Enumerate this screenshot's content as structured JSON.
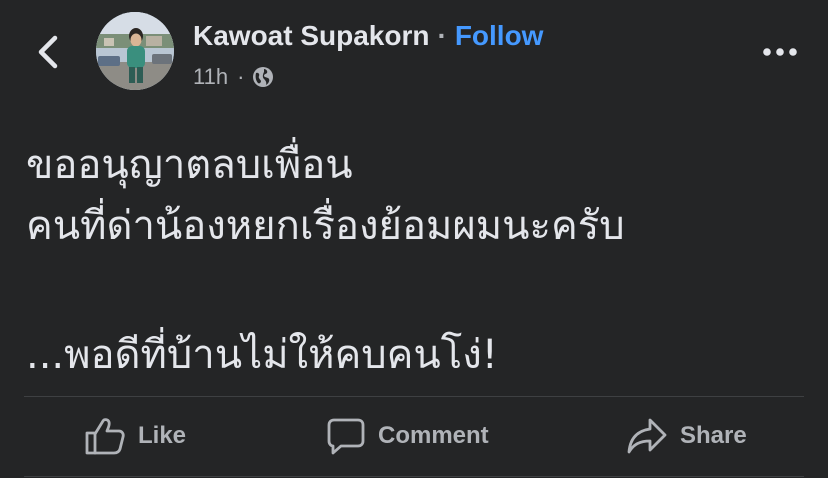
{
  "header": {
    "back_icon": "chevron-left-icon",
    "author_name": "Kawoat Supakorn",
    "separator": "·",
    "follow_label": "Follow",
    "timestamp": "11h",
    "meta_separator": "·",
    "audience_icon": "globe-icon",
    "more_icon": "more-horizontal-icon"
  },
  "post": {
    "lines": [
      "ขออนุญาตลบเพื่อน",
      "คนที่ด่าน้องหยกเรื่องย้อมผมนะครับ",
      "...พอดีที่บ้านไม่ให้คบคนโง่!"
    ]
  },
  "actions": {
    "like_label": "Like",
    "comment_label": "Comment",
    "share_label": "Share"
  },
  "colors": {
    "background": "#242526",
    "text_primary": "#e4e6eb",
    "text_secondary": "#b0b3b8",
    "link": "#4599ff",
    "divider": "#3e4042"
  }
}
